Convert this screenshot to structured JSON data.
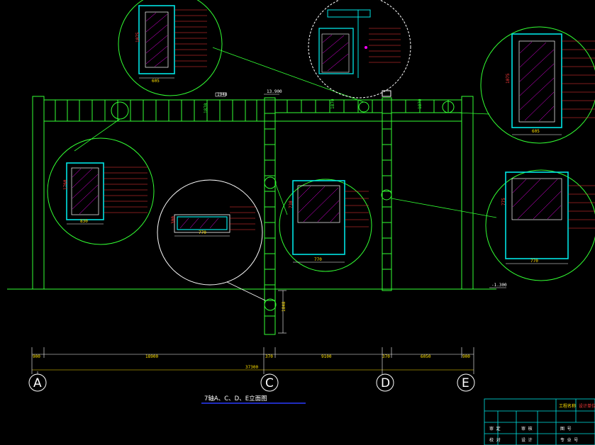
{
  "drawing": {
    "title": "7轴A、C、D、E立面图",
    "axes": [
      {
        "label": "A"
      },
      {
        "label": "C"
      },
      {
        "label": "D"
      },
      {
        "label": "E"
      }
    ],
    "segment_dims": [
      "900",
      "18900",
      "370",
      "9100",
      "370",
      "6050",
      "900"
    ],
    "total_dim": "37300",
    "top_elevation": "13.900",
    "bottom_elevation": "-1.300",
    "column_height": "1848",
    "beam_tags": [
      "1948",
      "1870",
      "1870",
      "1870"
    ],
    "color_white": "#ffffff",
    "color_green": "#33ff33",
    "color_cyan": "#00e5e5",
    "color_magenta": "#ff00ff",
    "color_yellow": "#ffe000",
    "color_red": "#ff3b3b",
    "color_blue": "#2a3cff"
  },
  "details": [
    {
      "dim_w": "605",
      "dim_h": "1075"
    },
    {
      "dim_w": "605",
      "dim_h": "1075"
    },
    {
      "dim_w": "830",
      "dim_h": "1760"
    },
    {
      "dim_w": "770",
      "dim_h": "300"
    },
    {
      "dim_w": "770",
      "dim_h": "738"
    },
    {
      "dim_w": "770",
      "dim_h": "775"
    },
    {
      "dim_w": "",
      "dim_h": ""
    }
  ],
  "title_block": {
    "col_a_row1": "审 定",
    "col_a_row2": "校 对",
    "col_b_row1": "审 核",
    "col_b_row2": "设 计",
    "project_label": "工程名称",
    "company_label": "设计单位",
    "sheet_label": "图 号",
    "drawing_no_label": "专 业 号"
  }
}
